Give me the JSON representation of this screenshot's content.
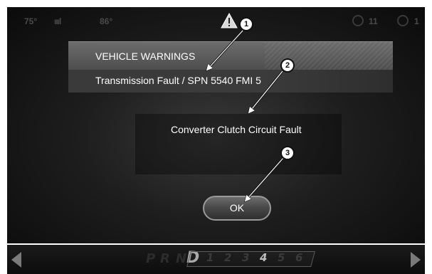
{
  "status_bar": {
    "outside_temp": "75°",
    "signal": "ıııl",
    "inside_temp": "86°",
    "right_value_1": "11",
    "right_value_2": "1"
  },
  "dialog": {
    "title": "VEHICLE WARNINGS",
    "fault_line": "Transmission Fault / SPN 5540 FMI 5",
    "fault_description": "Converter Clutch Circuit Fault",
    "ok_label": "OK"
  },
  "gear_selector": {
    "letters": [
      "P",
      "R",
      "N",
      "D"
    ],
    "active_letter": "D",
    "numbers": [
      "1",
      "2",
      "3",
      "4",
      "5",
      "6"
    ],
    "active_number": "4"
  },
  "callouts": [
    "1",
    "2",
    "3"
  ],
  "colors": {
    "panel": "#5a5a5a",
    "screen_bg": "#1e1e1e",
    "text": "#ffffff"
  }
}
